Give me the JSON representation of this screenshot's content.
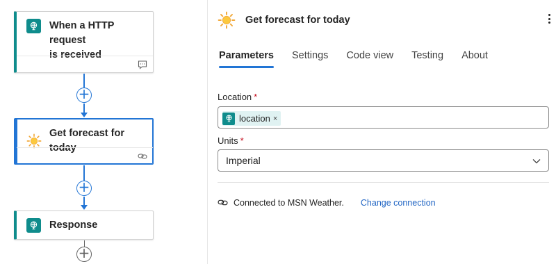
{
  "flow": {
    "steps": [
      {
        "title_line1": "When a HTTP request",
        "title_line2": "is received",
        "icon": "http-request-icon",
        "footer_icon": "comment-icon"
      },
      {
        "title": "Get forecast for today",
        "icon": "sun-icon",
        "footer_icon": "link-icon"
      },
      {
        "title": "Response",
        "icon": "http-response-icon"
      }
    ],
    "add_button_label": "+",
    "colors": {
      "accent": "#2275d5",
      "teal": "#0f8c8c"
    }
  },
  "panel": {
    "title": "Get forecast for today",
    "tabs": [
      {
        "label": "Parameters"
      },
      {
        "label": "Settings"
      },
      {
        "label": "Code view"
      },
      {
        "label": "Testing"
      },
      {
        "label": "About"
      }
    ],
    "location": {
      "label": "Location",
      "required_mark": "*",
      "token": "location",
      "token_remove": "×"
    },
    "units": {
      "label": "Units",
      "required_mark": "*",
      "value": "Imperial"
    },
    "connection": {
      "text": "Connected to MSN Weather.",
      "link": "Change connection"
    }
  }
}
